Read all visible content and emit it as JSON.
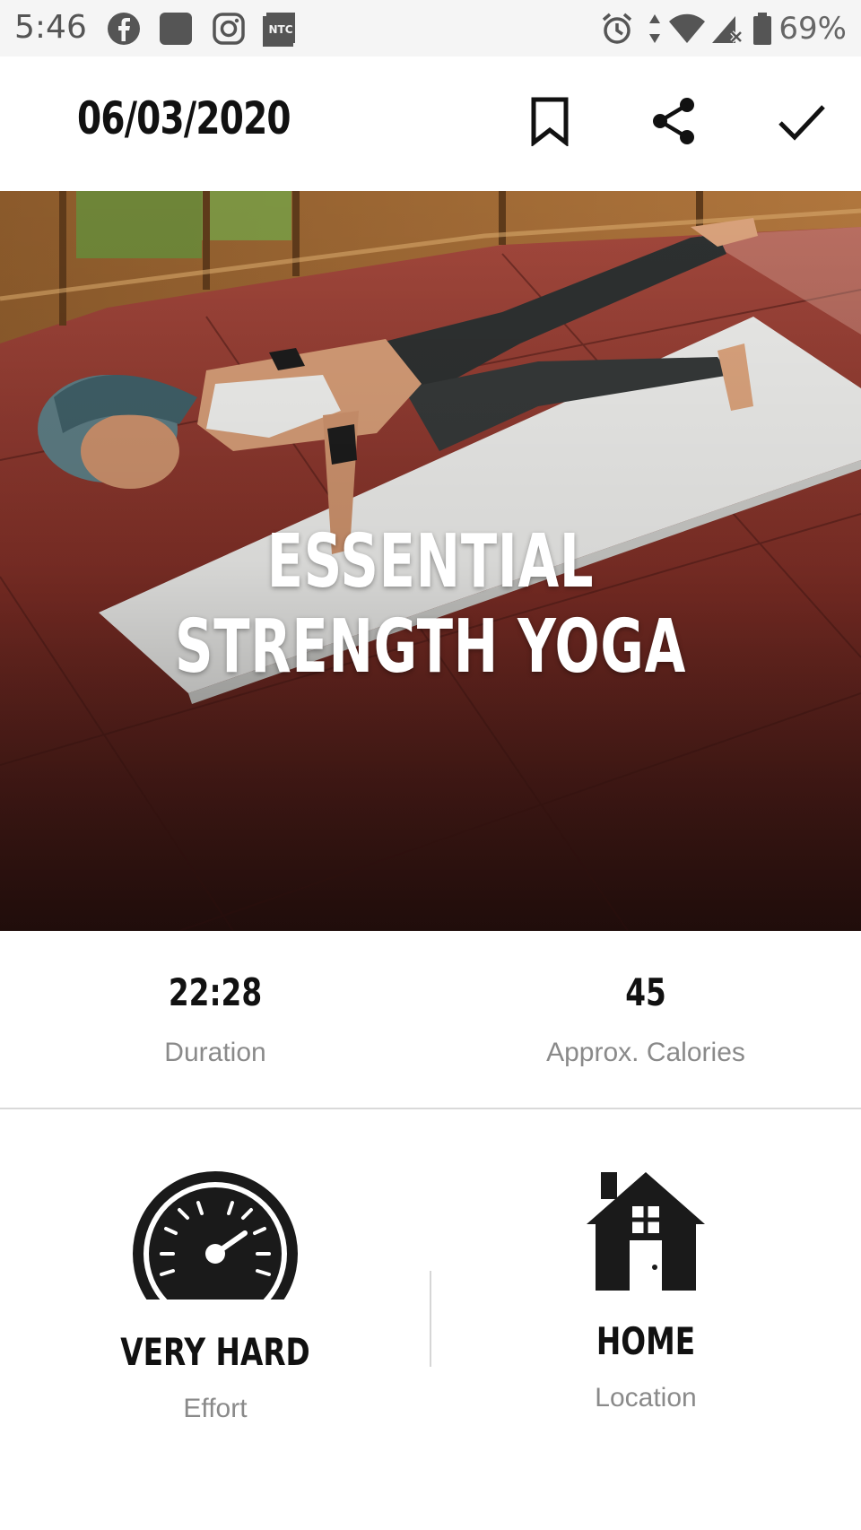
{
  "status_bar": {
    "time": "5:46",
    "battery": "69%",
    "icons": [
      "facebook-icon",
      "app-icon",
      "instagram-icon",
      "ntc-icon",
      "alarm-icon",
      "data-icon",
      "wifi-icon",
      "signal-icon",
      "battery-icon"
    ],
    "ntc_label": "NTC"
  },
  "header": {
    "date": "06/03/2020",
    "icons": [
      "bookmark-icon",
      "share-icon",
      "check-icon"
    ]
  },
  "hero": {
    "title": "ESSENTIAL STRENGTH YOGA"
  },
  "stats": {
    "duration_value": "22:28",
    "duration_label": "Duration",
    "calories_value": "45",
    "calories_label": "Approx. Calories"
  },
  "details": {
    "effort_value": "VERY HARD",
    "effort_label": "Effort",
    "location_value": "HOME",
    "location_label": "Location"
  },
  "colors": {
    "status_bg": "#f5f5f5",
    "text": "#111111",
    "muted": "#8a8a8a",
    "floor": "#7a2a22"
  }
}
